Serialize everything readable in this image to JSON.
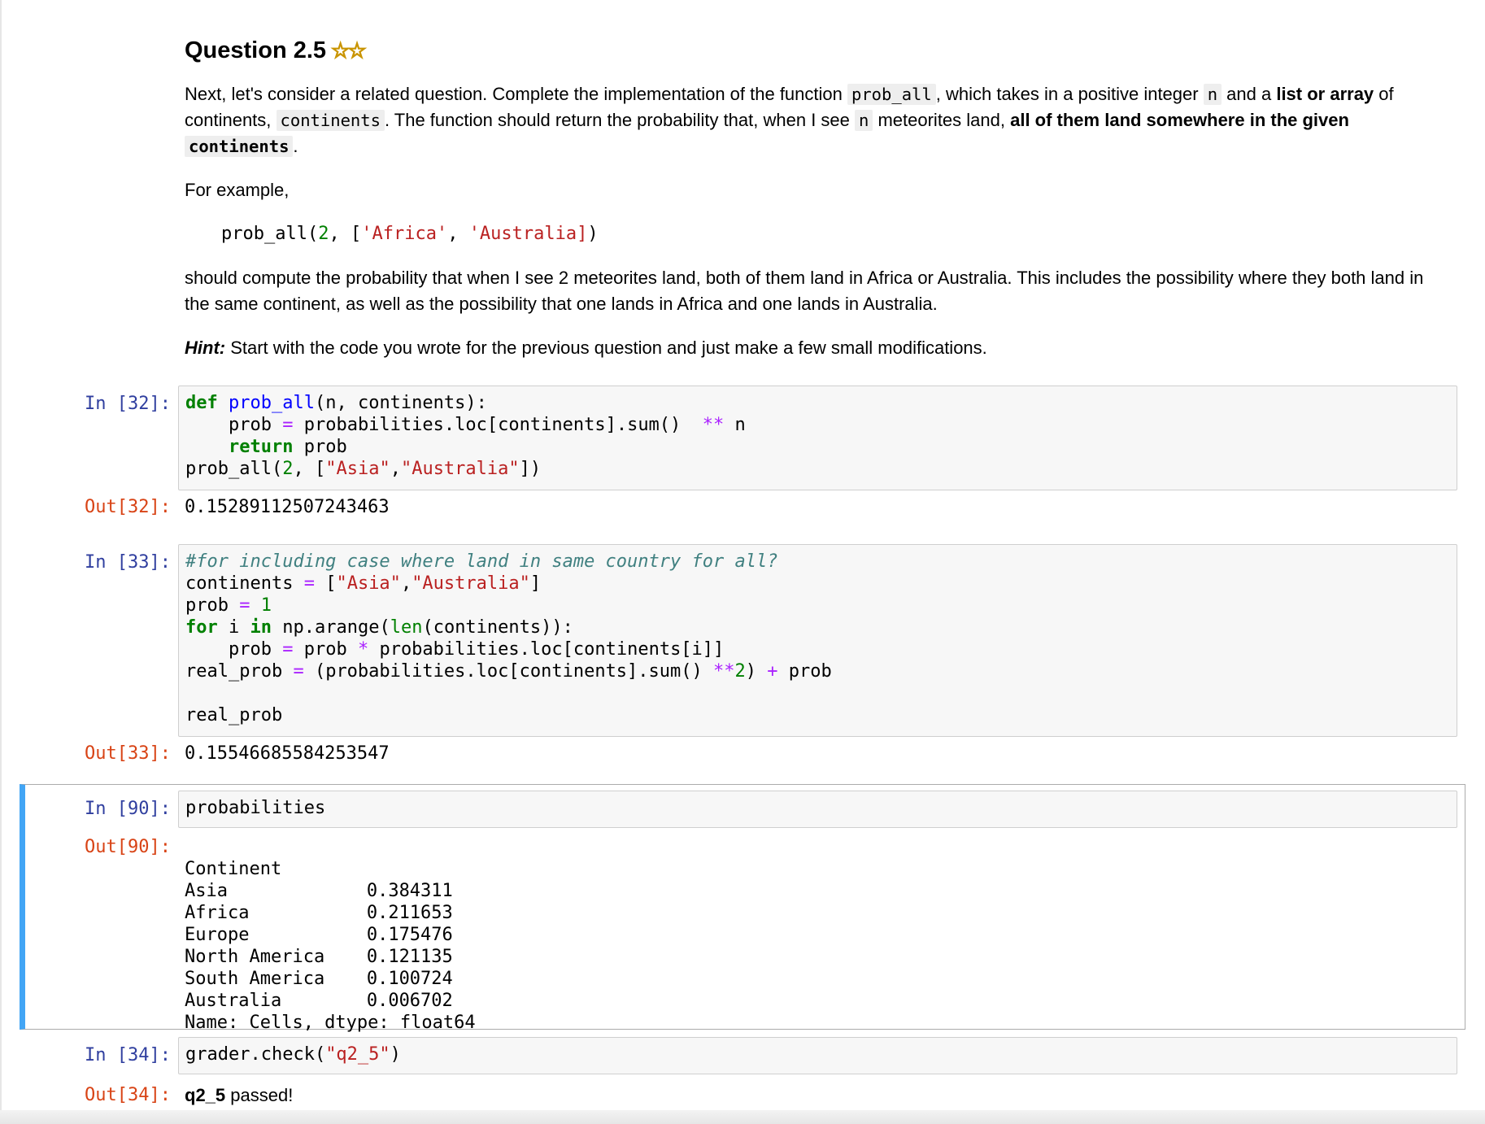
{
  "markdown": {
    "title": "Question 2.5",
    "stars": "☆☆",
    "p1_a": "Next, let's consider a related question. Complete the implementation of the function ",
    "p1_code_fn": "prob_all",
    "p1_b": ", which takes in a positive integer ",
    "p1_code_n": "n",
    "p1_c": " and a ",
    "p1_bold1": "list or array",
    "p1_d": " of continents, ",
    "p1_code_cont": "continents",
    "p1_e": ". The function should return the probability that, when I see ",
    "p1_code_n2": "n",
    "p1_f": " meteorites land, ",
    "p1_bold2": "all of them land somewhere in the given",
    "p1_code_cont2": "continents",
    "p1_g": ".",
    "p2": "For example,",
    "example_fn": "prob_all(",
    "example_num": "2",
    "example_mid": ", [",
    "example_s1": "'Africa'",
    "example_comma": ", ",
    "example_s2": "'Australia]",
    "example_end": ")",
    "p3": "should compute the probability that when I see 2 meteorites land, both of them land in Africa or Australia. This includes the possibility where they both land in the same continent, as well as the possibility that one lands in Africa and one lands in Australia.",
    "hint_label": "Hint:",
    "hint_text": " Start with the code you wrote for the previous question and just make a few small modifications."
  },
  "cells": {
    "c32": {
      "in_prompt": "In [32]:",
      "out_prompt": "Out[32]:",
      "output": "0.15289112507243463"
    },
    "c33": {
      "in_prompt": "In [33]:",
      "out_prompt": "Out[33]:",
      "output": "0.15546685584253547"
    },
    "c90": {
      "in_prompt": "In [90]:",
      "out_prompt": "Out[90]:",
      "input": "probabilities",
      "output_header": "Continent",
      "rows": [
        {
          "name": "Asia",
          "value": "0.384311"
        },
        {
          "name": "Africa",
          "value": "0.211653"
        },
        {
          "name": "Europe",
          "value": "0.175476"
        },
        {
          "name": "North America",
          "value": "0.121135"
        },
        {
          "name": "South America",
          "value": "0.100724"
        },
        {
          "name": "Australia",
          "value": "0.006702"
        }
      ],
      "output_footer": "Name: Cells, dtype: float64"
    },
    "c34": {
      "in_prompt": "In [34]:",
      "out_prompt": "Out[34]:",
      "output_code": "q2_5",
      "output_text": " passed!"
    }
  },
  "code": {
    "c32_l1_kw": "def",
    "c32_l1_fn": "prob_all",
    "c32_l1_rest": "(n, continents):",
    "c32_l2_a": "    prob ",
    "c32_l2_op": "=",
    "c32_l2_b": " probabilities.loc[continents].sum()  ",
    "c32_l2_op2": "**",
    "c32_l2_c": " n",
    "c32_l3_kw": "return",
    "c32_l3_rest": " prob",
    "c32_l4_a": "prob_all(",
    "c32_l4_num": "2",
    "c32_l4_b": ", [",
    "c32_l4_s1": "\"Asia\"",
    "c32_l4_comma": ",",
    "c32_l4_s2": "\"Australia\"",
    "c32_l4_c": "])",
    "c33_l1_cm": "#for including case where land in same country for all?",
    "c33_l2_a": "continents ",
    "c33_l2_op": "=",
    "c33_l2_b": " [",
    "c33_l2_s1": "\"Asia\"",
    "c33_l2_comma": ",",
    "c33_l2_s2": "\"Australia\"",
    "c33_l2_c": "]",
    "c33_l3_a": "prob ",
    "c33_l3_op": "=",
    "c33_l3_num": "1",
    "c33_l4_kw1": "for",
    "c33_l4_a": " i ",
    "c33_l4_kw2": "in",
    "c33_l4_b": " np.arange(",
    "c33_l4_bi": "len",
    "c33_l4_c": "(continents)):",
    "c33_l5_a": "    prob ",
    "c33_l5_op": "=",
    "c33_l5_b": " prob ",
    "c33_l5_op2": "*",
    "c33_l5_c": " probabilities.loc[continents[i]]",
    "c33_l6_a": "real_prob ",
    "c33_l6_op": "=",
    "c33_l6_b": " (probabilities.loc[continents].sum() ",
    "c33_l6_op2": "**",
    "c33_l6_num": "2",
    "c33_l6_c": ") ",
    "c33_l6_op3": "+",
    "c33_l6_d": " prob",
    "c33_l8": "real_prob",
    "c34_a": "grader.check(",
    "c34_s": "\"q2_5\"",
    "c34_b": ")"
  }
}
